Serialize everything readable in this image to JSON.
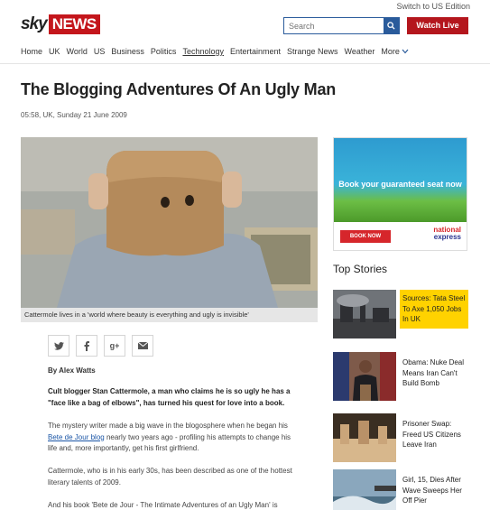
{
  "header": {
    "edition_link": "Switch to US Edition",
    "logo": {
      "sky": "sky",
      "news": "NEWS"
    },
    "search_placeholder": "Search",
    "watch_live": "Watch Live"
  },
  "nav": {
    "items": [
      "Home",
      "UK",
      "World",
      "US",
      "Business",
      "Politics",
      "Technology",
      "Entertainment",
      "Strange News",
      "Weather"
    ],
    "active": "Technology",
    "more": "More"
  },
  "article": {
    "headline": "The Blogging Adventures Of An Ugly Man",
    "dateline": "05:58, UK, Sunday 21 June 2009",
    "caption": "Cattermole lives in a 'world where beauty is everything and ugly is invisible'",
    "share_icons": [
      "twitter-icon",
      "facebook-icon",
      "google-plus-icon",
      "email-icon"
    ],
    "byline": "By Alex Watts",
    "lead": "Cult blogger Stan Cattermole, a man who claims he is so ugly he has a \"face like a bag of elbows\", has turned his quest for love into a book.",
    "p1_before": "The mystery writer made a big wave in the blogosphere when he began his ",
    "p1_link": "Bete de Jour blog",
    "p1_after": " nearly two years ago - profiling his attempts to change his life and, more importantly, get his first girlfriend.",
    "p2": "Cattermole, who is in his early 30s, has been described as one of the hottest literary talents of 2009.",
    "p3": "And his book 'Bete de Jour - The Intimate Adventures of an Ugly Man' is"
  },
  "ad": {
    "headline": "Book your guaranteed seat now",
    "button": "BOOK NOW",
    "brand_line1": "national",
    "brand_line2": "express"
  },
  "sidebar": {
    "title": "Top Stories",
    "stories": [
      {
        "text": "Sources: Tata Steel To Axe 1,050 Jobs In UK",
        "highlight": true
      },
      {
        "text": "Obama: Nuke Deal Means Iran Can't Build Bomb",
        "highlight": false
      },
      {
        "text": "Prisoner Swap: Freed US Citizens Leave Iran",
        "highlight": false
      },
      {
        "text": "Girl, 15, Dies After Wave Sweeps Her Off Pier",
        "highlight": false
      }
    ]
  },
  "colors": {
    "brand_red": "#c4161c",
    "search_blue": "#2a5b9b",
    "watch_live_red": "#b4161d",
    "highlight_yellow": "#ffd200",
    "link_blue": "#1a55a6"
  }
}
